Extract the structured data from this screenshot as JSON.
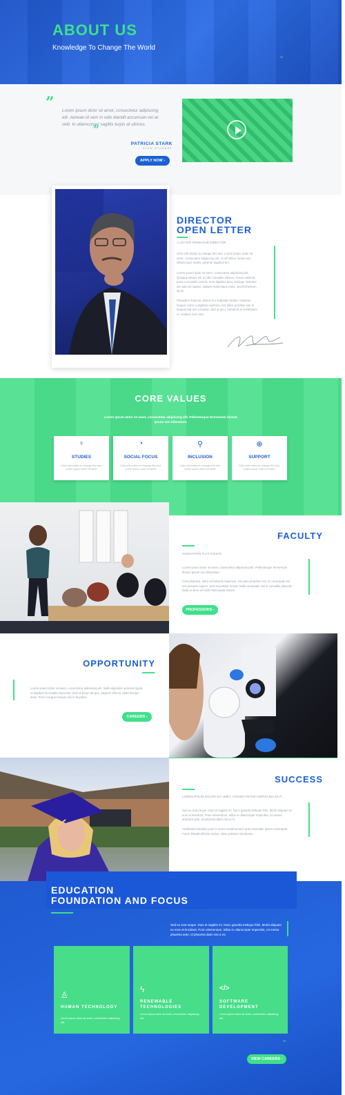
{
  "hero": {
    "title": "ABOUT US",
    "subtitle": "Knowledge To Change The World"
  },
  "testimonial": {
    "quote": "Lorem ipsum dolor sit amet, consectetur adipiscing elit. Aenean id sem in odio blandit accumsan vel ac velit. In ullamcorper sagittis turpis at ultrices.",
    "name": "PATRICIA STARK",
    "role": "STEM STUDENT",
    "button": "APPLY NOW ›"
  },
  "director": {
    "title_line1": "DIRECTOR",
    "title_line2": "OPEN LETTER",
    "tagline": "A LETTER FROM OUR DIRECTOR",
    "p1": "Click edit button to change this text. Lorem ipsum dolor sit amet, consectetur adipiscing elit. Ut elit tellus, luctus nec ullamcorper mattis, pulvinar dapibus leo.",
    "p2": "Lorem ipsum dolor sit amet, consectetur adipiscing elit. Quisque dictum elit ut odio convallis ultrices. Fusce eleifend, justo a convallis viverra, eros dapibus arcu, tristique molestie elit odio vel sapien. Nullam scelerisque dolor, sed fermentum lacus.",
    "p3": "Phasellus rhoncus, dictum leo vulputate facilisi. Vivamus feugiat, tortor a dapibus euismod, nisi tellus pulvinar nisl, in feugiat erat nisi a massa. Sed ut arcu, hendrerit at vestibulum et, sodales non nunc.",
    "signature": "Jeff Roger"
  },
  "core_values": {
    "title": "CORE VALUES",
    "intro": "Lorem ipsum dolor sit amet, consectetur adipiscing elit. Pellentesque fermentum dictum ipsum non bibendum.",
    "cards": [
      {
        "icon": "lightbulb-icon",
        "glyph": "♀",
        "title": "STUDIES",
        "text": "Click edit button to change this text. Lorem ipsum dolor sit amet."
      },
      {
        "icon": "globe-icon",
        "glyph": "◔",
        "title": "SOCIAL FOCUS",
        "text": "Click edit button to change this text. Lorem ipsum dolor sit amet."
      },
      {
        "icon": "network-icon",
        "glyph": "⚲",
        "title": "INCLUSION",
        "text": "Click edit button to change this text. Lorem ipsum dolor sit amet."
      },
      {
        "icon": "lifebuoy-icon",
        "glyph": "⊕",
        "title": "SUPPORT",
        "text": "Click edit button to change this text. Lorem ipsum dolor sit amet."
      }
    ]
  },
  "faculty": {
    "title": "FACULTY",
    "tagline": "INNOVATION THAT EXISTS",
    "p1": "Lorem ipsum dolor sit amet, consectetur adipiscing elit. Pellentesque fermentum dictum ipsum non bibendum.",
    "p2": "Cras pharetra, dolor vel lobortis maximus, est justo pharetra nisl, id consequat nisl nisi posuere sapien. Sed at porttitor metus. Nulla venenatis nisl id convallis placerat. Nulla et arcu vel nibh malesuada rutrum.",
    "button": "PROFESSORS ›"
  },
  "opportunity": {
    "title": "OPPORTUNITY",
    "text": "Lorem ipsum dolor sit amet, consectetur adipiscing elit. Nulla dignissim pulvinar ligula, et dapibus leo mattis imperdiet. Sed id ipsum tempor, aliquam felis at, pellentesque dolor. Proin congue tempus nisi in faucibus.",
    "button": "CAREERS ›"
  },
  "success": {
    "title": "SUCCESS",
    "tagline": "LOREM IPSUM DOLOR SIT AMET, CONSECTETUR ADIPISCING ELIT.",
    "p1": "Sed eu erat neque. Duis et sagittis mi. Nunc gravida tristique felis. Morbi aliquam ex eros et tincidunt. Proin elementum, tellus in ullamcorper imperdiet, mi metus pharetra ante, id pharetra diam nisi a mi.",
    "p2": "Vestibulum facilisis justo in lorem condimentum quis venenatis ipsum consequat. Fusce blandit efficitur metus, vitae pulvinar nisi dictum."
  },
  "education": {
    "title_line1": "EDUCATION",
    "title_line2": "FOUNDATION AND FOCUS",
    "text": "Sed eu erat neque. Duis et sagittis mi. Nunc gravida tristique felis. Morbi aliquam ex eros et tincidunt. Proin elementum, tellus in ullamcorper imperdiet, mi metus pharetra ante, id pharetra diam nisi a mi.",
    "cards": [
      {
        "icon": "person-icon",
        "glyph": "♙",
        "title_line1": "HUMAN TECHNOLOGY",
        "title_line2": "",
        "text": "Lorem ipsum dolor sit amet, consectetur adipiscing elit."
      },
      {
        "icon": "lightning-icon",
        "glyph": "ϟ",
        "title_line1": "RENEWABLE",
        "title_line2": "TECHNOLOGIES",
        "text": "Lorem ipsum dolor sit amet, consectetur adipiscing elit."
      },
      {
        "icon": "code-icon",
        "glyph": "</>",
        "title_line1": "SOFTWARE",
        "title_line2": "DEVELOPMENT",
        "text": "Lorem ipsum dolor sit amet, consectetur adipiscing elit."
      }
    ],
    "button": "VIEW CAREERS ›"
  },
  "colors": {
    "brand_blue": "#1a5fd6",
    "accent_green": "#3fe08a"
  }
}
